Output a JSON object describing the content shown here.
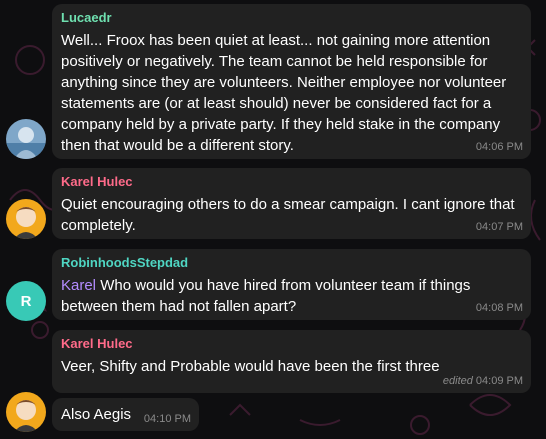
{
  "messages": [
    {
      "sender": "Lucaedr",
      "sender_color": "#6fe0b0",
      "text": "Well... Froox has been quiet at least... not gaining more attention positively or negatively. The team cannot be held responsible for anything since they are volunteers. Neither employee nor volunteer statements are (or at least should) never be considered fact for a company held  by a private party. If they held stake in the company then that would be a different story.",
      "time": "04:06 PM"
    },
    {
      "sender": "Karel Hulec",
      "sender_color": "#ff6b8a",
      "text": "Quiet encouraging others to do a smear campaign. I cant ignore that completely.",
      "time": "04:07 PM"
    },
    {
      "sender": "RobinhoodsStepdad",
      "sender_color": "#4fd6c3",
      "mention": "Karel",
      "text": " Who would you have hired from volunteer team if things between them had not fallen apart?",
      "time": "04:08 PM",
      "avatar_letter": "R",
      "avatar_color": "#38c9b6"
    },
    {
      "sender": "Karel Hulec",
      "sender_color": "#ff6b8a",
      "text": "Veer, Shifty and Probable would have been the first three",
      "edited": "edited",
      "time": "04:09 PM"
    },
    {
      "text": "Also Aegis",
      "time": "04:10 PM"
    }
  ]
}
